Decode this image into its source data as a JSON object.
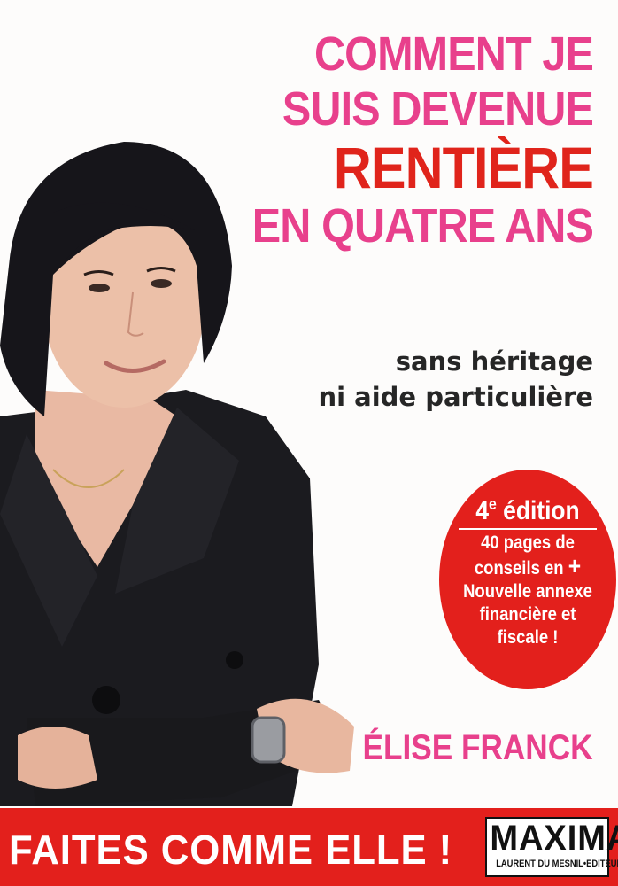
{
  "cover": {
    "title_lines": [
      "COMMENT JE",
      "SUIS DEVENUE",
      "RENTIÈRE",
      "EN QUATRE ANS"
    ],
    "subtitle_lines": [
      "sans héritage",
      "ni aide particulière"
    ],
    "badge": {
      "edition_number": "4",
      "edition_suffix": "e",
      "edition_word": "édition",
      "lines": [
        "40 pages de",
        "conseils en",
        "Nouvelle annexe",
        "financière et",
        "fiscale !"
      ],
      "plus": "+"
    },
    "author": "ÉLISE FRANCK",
    "slogan": "FAITES COMME ELLE !",
    "publisher": {
      "logo": "MAXIMA",
      "imprint": "LAURENT DU MESNIL•EDITEUR"
    }
  },
  "colors": {
    "title_pink": "#e8408c",
    "accent_red": "#e0241b",
    "banner_red": "#e3201c",
    "text_dark": "#262626"
  }
}
